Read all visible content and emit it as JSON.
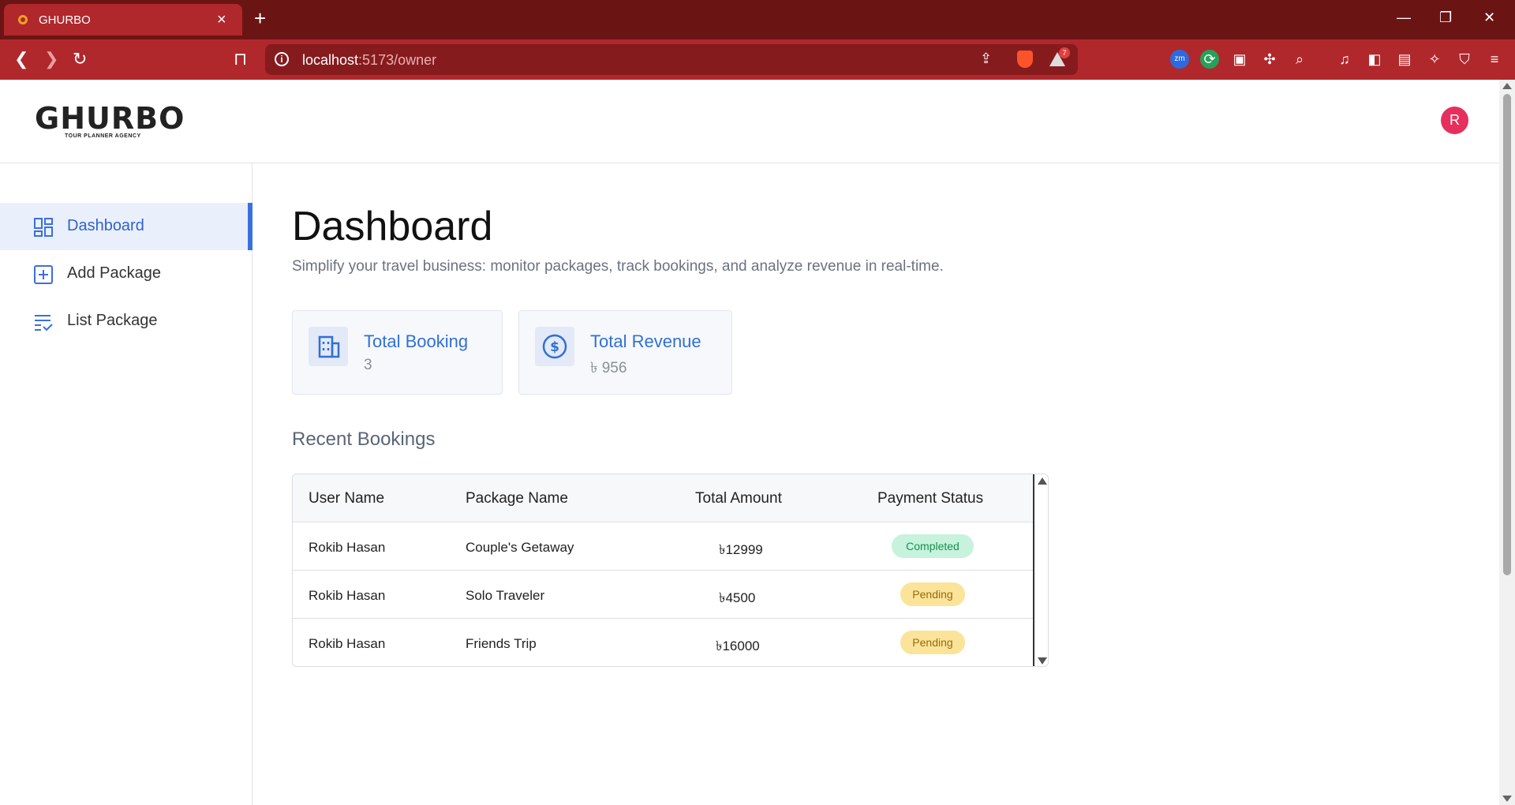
{
  "browser": {
    "tab_title": "GHURBO",
    "url_host": "localhost",
    "url_path": ":5173/owner",
    "rewards_count": "7",
    "theme_color": "#b0282c"
  },
  "header": {
    "logo_main": "GHURBO",
    "logo_sub": "TOUR PLANNER AGENCY",
    "avatar_initial": "R",
    "avatar_color": "#e5305d"
  },
  "sidebar": {
    "items": [
      {
        "label": "Dashboard",
        "icon": "dashboard-icon",
        "active": true
      },
      {
        "label": "Add Package",
        "icon": "add-box-icon",
        "active": false
      },
      {
        "label": "List Package",
        "icon": "list-checks-icon",
        "active": false
      }
    ]
  },
  "main": {
    "title": "Dashboard",
    "subtitle": "Simplify your travel business: monitor packages, track bookings, and analyze revenue in real-time.",
    "stats": [
      {
        "label": "Total Booking",
        "value": "3",
        "icon": "building-icon"
      },
      {
        "label": "Total Revenue",
        "value": "৳ 956",
        "icon": "dollar-circle-icon"
      }
    ],
    "recent_title": "Recent Bookings",
    "table": {
      "headers": [
        "User Name",
        "Package Name",
        "Total Amount",
        "Payment Status"
      ],
      "rows": [
        {
          "user": "Rokib Hasan",
          "package": "Couple's Getaway",
          "amount": "৳12999",
          "status": "Completed"
        },
        {
          "user": "Rokib Hasan",
          "package": "Solo Traveler",
          "amount": "৳4500",
          "status": "Pending"
        },
        {
          "user": "Rokib Hasan",
          "package": "Friends Trip",
          "amount": "৳16000",
          "status": "Pending"
        }
      ]
    },
    "accent_color": "#3070d6"
  }
}
